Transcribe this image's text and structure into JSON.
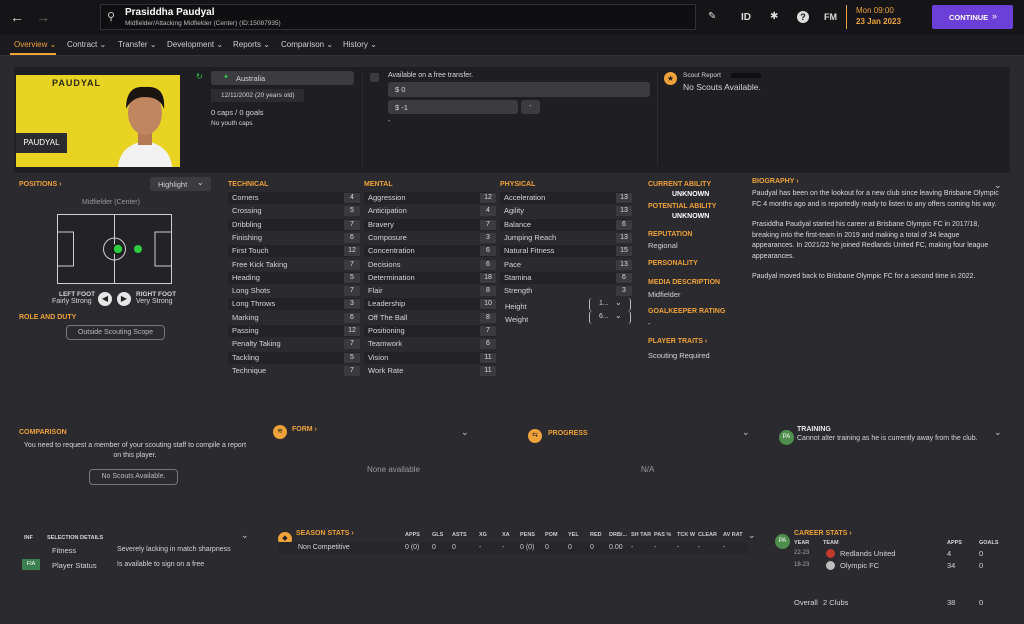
{
  "topbar": {
    "player_name": "Prasiddha Paudyal",
    "player_sub": "Midfielder/Attacking Midfielder (Center) (ID:15087935)",
    "id_label": "ID",
    "fm_label": "FM",
    "time": "Mon 09:00",
    "date": "23 Jan 2023",
    "continue_label": "CONTINUE"
  },
  "tabs": [
    {
      "label": "Overview",
      "active": true
    },
    {
      "label": "Contract"
    },
    {
      "label": "Transfer"
    },
    {
      "label": "Development"
    },
    {
      "label": "Reports"
    },
    {
      "label": "Comparison"
    },
    {
      "label": "History"
    }
  ],
  "profile": {
    "banner_name": "PAUDYAL",
    "name_tag": "PAUDYAL",
    "nation": "Australia",
    "dob": "12/11/2002 (20 years old)",
    "caps": "0 caps / 0 goals",
    "youth": "No youth caps",
    "transfer_title": "Available on a free transfer.",
    "value": "$ 0",
    "wage": "$ -1",
    "dash": "-",
    "scout_title": "Scout Report",
    "scout_text": "No Scouts Available."
  },
  "positions": {
    "title": "POSITIONS",
    "highlight": "Highlight",
    "position_name": "Midfielder (Center)",
    "left_foot_label": "LEFT FOOT",
    "left_foot_value": "Fairly Strong",
    "right_foot_label": "RIGHT FOOT",
    "right_foot_value": "Very Strong",
    "role_title": "ROLE AND DUTY",
    "role_button": "Outside Scouting Scope"
  },
  "technical": {
    "title": "TECHNICAL",
    "rows": [
      {
        "name": "Corners",
        "value": "4"
      },
      {
        "name": "Crossing",
        "value": "5"
      },
      {
        "name": "Dribbling",
        "value": "7"
      },
      {
        "name": "Finishing",
        "value": "6"
      },
      {
        "name": "First Touch",
        "value": "12"
      },
      {
        "name": "Free Kick Taking",
        "value": "7"
      },
      {
        "name": "Heading",
        "value": "5"
      },
      {
        "name": "Long Shots",
        "value": "7"
      },
      {
        "name": "Long Throws",
        "value": "3"
      },
      {
        "name": "Marking",
        "value": "6"
      },
      {
        "name": "Passing",
        "value": "12"
      },
      {
        "name": "Penalty Taking",
        "value": "7"
      },
      {
        "name": "Tackling",
        "value": "5"
      },
      {
        "name": "Technique",
        "value": "7"
      }
    ]
  },
  "mental": {
    "title": "MENTAL",
    "rows": [
      {
        "name": "Aggression",
        "value": "12"
      },
      {
        "name": "Anticipation",
        "value": "4"
      },
      {
        "name": "Bravery",
        "value": "7"
      },
      {
        "name": "Composure",
        "value": "3"
      },
      {
        "name": "Concentration",
        "value": "6"
      },
      {
        "name": "Decisions",
        "value": "6"
      },
      {
        "name": "Determination",
        "value": "18"
      },
      {
        "name": "Flair",
        "value": "8"
      },
      {
        "name": "Leadership",
        "value": "10"
      },
      {
        "name": "Off The Ball",
        "value": "8"
      },
      {
        "name": "Positioning",
        "value": "7"
      },
      {
        "name": "Teamwork",
        "value": "6"
      },
      {
        "name": "Vision",
        "value": "11"
      },
      {
        "name": "Work Rate",
        "value": "11"
      }
    ]
  },
  "physical": {
    "title": "PHYSICAL",
    "rows": [
      {
        "name": "Acceleration",
        "value": "13"
      },
      {
        "name": "Agility",
        "value": "13"
      },
      {
        "name": "Balance",
        "value": "6"
      },
      {
        "name": "Jumping Reach",
        "value": "13"
      },
      {
        "name": "Natural Fitness",
        "value": "15"
      },
      {
        "name": "Pace",
        "value": "13"
      },
      {
        "name": "Stamina",
        "value": "6"
      },
      {
        "name": "Strength",
        "value": "3"
      }
    ],
    "height_label": "Height",
    "height_value": "1...",
    "weight_label": "Weight",
    "weight_value": "6..."
  },
  "ability": {
    "current_title": "CURRENT ABILITY",
    "current_value": "UNKNOWN",
    "potential_title": "POTENTIAL ABILITY",
    "potential_value": "UNKNOWN",
    "reputation_title": "REPUTATION",
    "reputation_value": "Regional",
    "personality_title": "PERSONALITY",
    "media_title": "MEDIA DESCRIPTION",
    "media_value": "Midfielder",
    "gk_title": "GOALKEEPER RATING",
    "gk_value": "-",
    "traits_title": "PLAYER TRAITS",
    "traits_value": "Scouting Required"
  },
  "biography": {
    "title": "BIOGRAPHY",
    "p1": "Paudyal has been on the lookout for a new club since leaving Brisbane Olympic FC 4 months ago and is reportedly ready to listen to any offers coming his way.",
    "p2": "Prasiddha Paudyal started his career at Brisbane Olympic FC in 2017/18, breaking into the first-team in 2019 and making a total of 34 league appearances. In 2021/22 he joined Redlands United FC, making four league appearances.",
    "p3": "Paudyal moved back to Brisbane Olympic FC for a second time in 2022."
  },
  "comparison": {
    "title": "COMPARISON",
    "text": "You need to request a member of your scouting staff to compile a report on this player.",
    "button": "No Scouts Available."
  },
  "form": {
    "title": "FORM",
    "text": "None available"
  },
  "progress": {
    "title": "PROGRESS",
    "text": "N/A"
  },
  "training": {
    "title": "TRAINING",
    "text": "Cannot alter training as he is currently away from the club.",
    "badge": "PA"
  },
  "selection": {
    "inf_header": "INF",
    "details_header": "SELECTION DETAILS",
    "rows": [
      {
        "inf": "",
        "label": "Fitness",
        "value": "Severely lacking in match sharpness"
      },
      {
        "inf": "FIA",
        "label": "Player Status",
        "value": "Is available to sign on a free"
      }
    ]
  },
  "season_stats": {
    "title": "SEASON STATS",
    "headers": [
      "APPS",
      "GLS",
      "ASTS",
      "XG",
      "XA",
      "PENS",
      "POM",
      "YEL",
      "RED",
      "DRB/...",
      "SH TAR",
      "PAS %",
      "TCK W",
      "CLEAR",
      "AV RAT"
    ],
    "row_label": "Non Competitive",
    "row": [
      "0 (0)",
      "0",
      "0",
      "-",
      "-",
      "0 (0)",
      "0",
      "0",
      "0",
      "0.00",
      "-",
      "-",
      "-",
      "-",
      "-"
    ]
  },
  "career_stats": {
    "title": "CAREER STATS",
    "badge": "PA",
    "year_header": "YEAR",
    "team_header": "TEAM",
    "apps_header": "APPS",
    "goals_header": "GOALS",
    "rows": [
      {
        "year": "22-23",
        "team": "Redlands United",
        "apps": "4",
        "goals": "0"
      },
      {
        "year": "18-23",
        "team": "Olympic FC",
        "apps": "34",
        "goals": "0"
      }
    ],
    "overall_label": "Overall",
    "overall_clubs": "2 Clubs",
    "overall_apps": "38",
    "overall_goals": "0"
  },
  "colors": {
    "accent": "#f0a23a",
    "continue": "#6b3fd8",
    "pitch_dot": "#2ecc40"
  }
}
